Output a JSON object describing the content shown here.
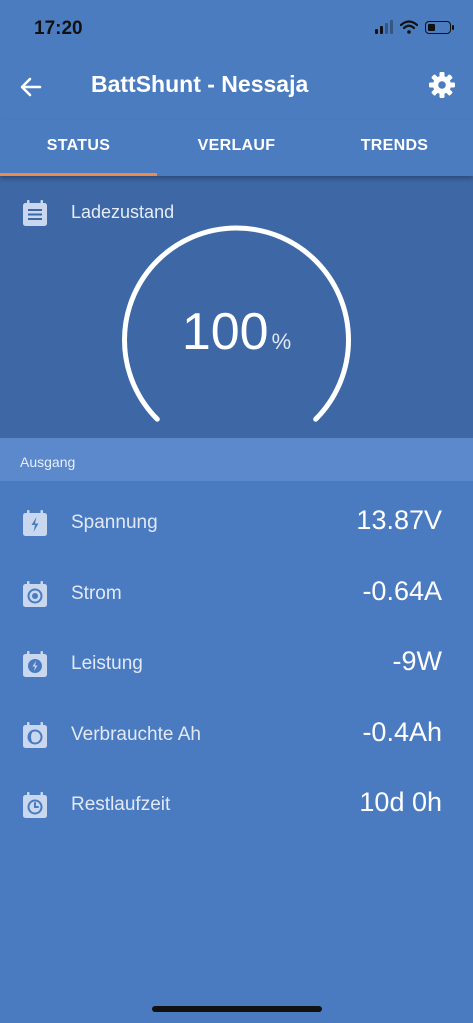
{
  "status_bar": {
    "time": "17:20",
    "signal_icon": "cellular-signal-icon",
    "wifi_icon": "wifi-icon",
    "battery_icon": "battery-low-icon"
  },
  "app_bar": {
    "title": "BattShunt - Nessaja",
    "back_icon": "arrow-left-icon",
    "settings_icon": "gear-icon"
  },
  "tabs": [
    {
      "label": "STATUS",
      "active": true
    },
    {
      "label": "VERLAUF",
      "active": false
    },
    {
      "label": "TRENDS",
      "active": false
    }
  ],
  "gauge": {
    "header_icon": "list-icon",
    "label": "Ladezustand",
    "value": "100",
    "unit": "%",
    "level": 1.0
  },
  "section": {
    "label": "Ausgang"
  },
  "rows": [
    {
      "icon": "lightning-icon",
      "label": "Spannung",
      "value": "13.87V"
    },
    {
      "icon": "target-icon",
      "label": "Strom",
      "value": "-0.64A"
    },
    {
      "icon": "power-icon",
      "label": "Leistung",
      "value": "-9W"
    },
    {
      "icon": "moon-icon",
      "label": "Verbrauchte Ah",
      "value": "-0.4Ah"
    },
    {
      "icon": "clock-icon",
      "label": "Restlaufzeit",
      "value": "10d 0h"
    }
  ],
  "colors": {
    "background": "#4a7bc0",
    "app_bar": "#4b7cc0",
    "gauge_panel": "#3d68a5",
    "section_header": "#5b89cb",
    "tab_indicator": "#f08a4b"
  }
}
